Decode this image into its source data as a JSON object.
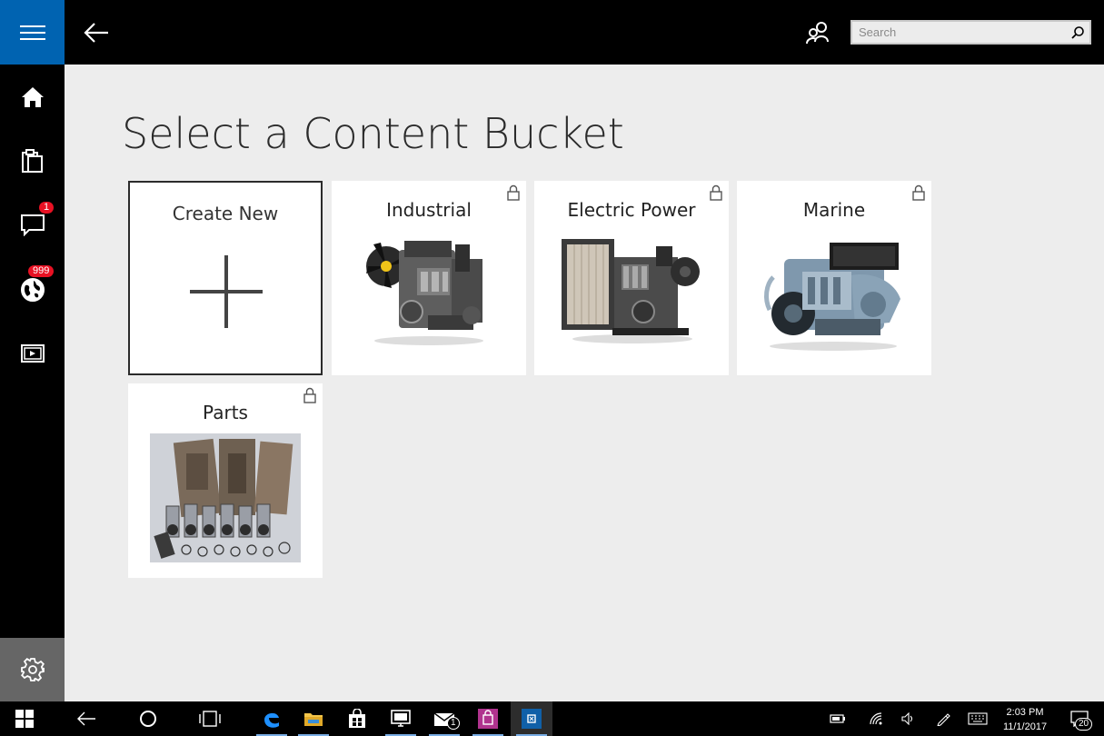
{
  "header": {
    "search_placeholder": "Search"
  },
  "sidebar": {
    "items": [
      {
        "name": "home-icon",
        "badge": ""
      },
      {
        "name": "clipboard-icon",
        "badge": ""
      },
      {
        "name": "messages-icon",
        "badge": "1"
      },
      {
        "name": "globe-icon",
        "badge": "999"
      },
      {
        "name": "media-icon",
        "badge": ""
      }
    ]
  },
  "main": {
    "title": "Select a Content Bucket",
    "create_label": "Create New",
    "buckets": [
      {
        "label": "Industrial",
        "locked": true,
        "image": "engine-industrial"
      },
      {
        "label": "Electric Power",
        "locked": true,
        "image": "generator-electric-power"
      },
      {
        "label": "Marine",
        "locked": true,
        "image": "engine-marine"
      },
      {
        "label": "Parts",
        "locked": true,
        "image": "parts-kit"
      }
    ]
  },
  "taskbar": {
    "time": "2:03 PM",
    "date": "11/1/2017",
    "mail_badge": "1",
    "notifications_count": "20"
  },
  "colors": {
    "accent": "#0063b1",
    "badge": "#e81123",
    "background": "#ededed"
  }
}
